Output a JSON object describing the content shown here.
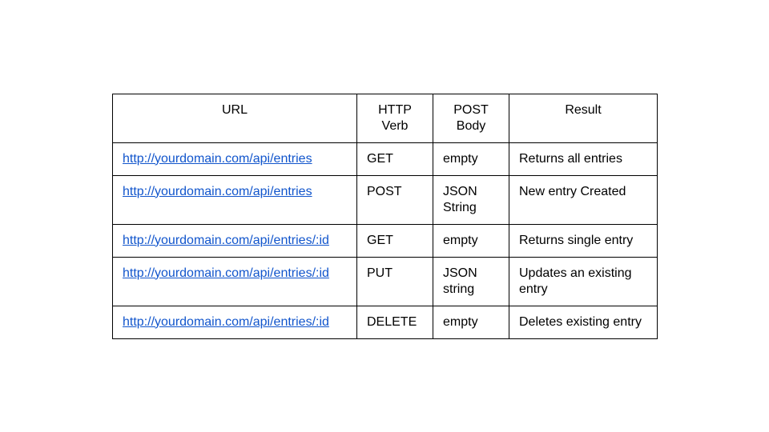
{
  "chart_data": {
    "type": "table",
    "headers": [
      "URL",
      "HTTP Verb",
      "POST Body",
      "Result"
    ],
    "rows": [
      {
        "url": "http://yourdomain.com/api/entries",
        "verb": "GET",
        "body": "empty",
        "result": "Returns all entries"
      },
      {
        "url": "http://yourdomain.com/api/entries",
        "verb": "POST",
        "body": "JSON String",
        "result": "New entry Created"
      },
      {
        "url": "http://yourdomain.com/api/entries/:id",
        "verb": "GET",
        "body": "empty",
        "result": "Returns single entry"
      },
      {
        "url": "http://yourdomain.com/api/entries/:id",
        "verb": "PUT",
        "body": "JSON string",
        "result": "Updates an existing entry"
      },
      {
        "url": "http://yourdomain.com/api/entries/:id",
        "verb": "DELETE",
        "body": "empty",
        "result": "Deletes existing entry"
      }
    ]
  }
}
